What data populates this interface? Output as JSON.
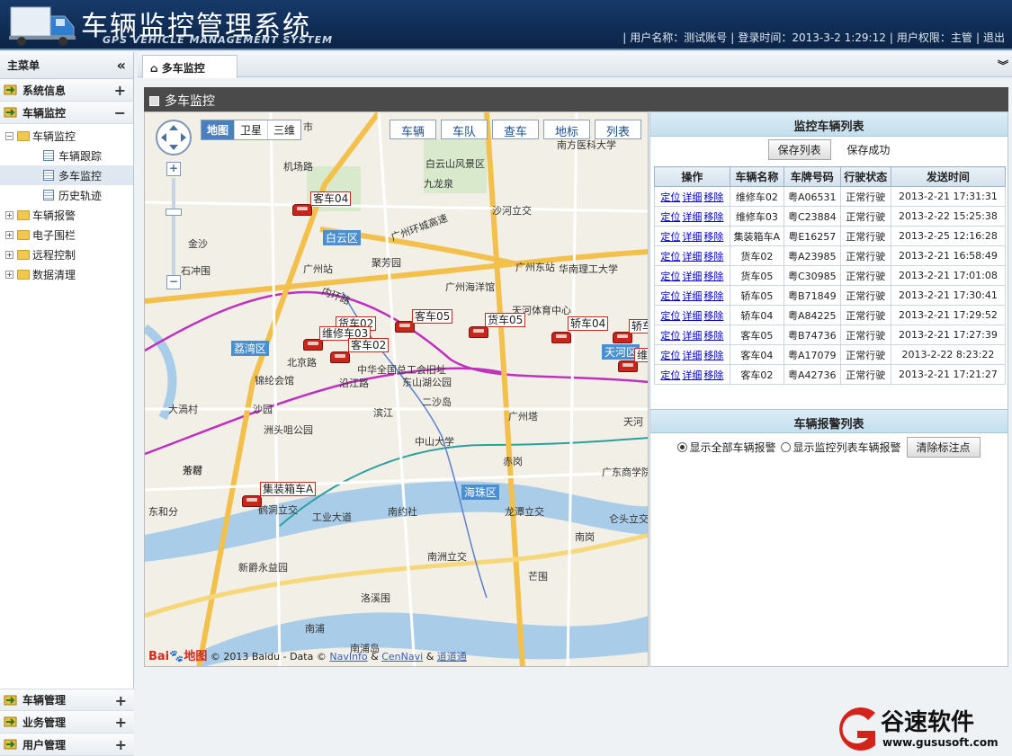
{
  "header": {
    "title": "车辆监控管理系统",
    "subtitle": "GPS VEHICLE MANAGEMENT SYSTEM",
    "user": "用户名称：测试账号",
    "login": "登录时间：2013-3-2 1:29:12",
    "role": "用户权限：主管",
    "logout": "退出"
  },
  "sidebar": {
    "title": "主菜单",
    "collapse": "«",
    "cats": [
      {
        "label": "系统信息",
        "pm": "+"
      },
      {
        "label": "车辆监控",
        "pm": "−"
      }
    ],
    "tree": {
      "root": "车辆监控",
      "children": [
        "车辆跟踪",
        "多车监控",
        "历史轨迹"
      ],
      "others": [
        "车辆报警",
        "电子围栏",
        "远程控制",
        "数据清理"
      ]
    },
    "bottom": [
      {
        "label": "车辆管理",
        "pm": "+"
      },
      {
        "label": "业务管理",
        "pm": "+"
      },
      {
        "label": "用户管理",
        "pm": "+"
      }
    ]
  },
  "tab": {
    "label": "多车监控"
  },
  "panel": {
    "title": "多车监控"
  },
  "map": {
    "types": [
      "地图",
      "卫星",
      "三维"
    ],
    "tools": [
      "车辆",
      "车队",
      "查车",
      "地标",
      "列表"
    ],
    "copyright": "© 2013 Baidu - Data ©",
    "navinfo": "NavInfo",
    "amp": "&",
    "cennavi": "CenNavi",
    "daodao": "道道通",
    "cars": [
      "客车04",
      "货车02",
      "维修车03",
      "客车02",
      "客车05",
      "货车05",
      "轿车04",
      "轿车",
      "维修",
      "集装箱车A"
    ],
    "places": [
      "机场路",
      "白云山风景区",
      "九龙泉",
      "沙河立交",
      "白云区",
      "广州站",
      "聚芳园",
      "广州东站",
      "广州海洋馆",
      "天河体育中心",
      "内环路",
      "荔湾区",
      "北京路",
      "锦纶会馆",
      "中华全国总工会旧址",
      "东山湖公园",
      "沿江路",
      "二沙岛",
      "广州塔",
      "滨江",
      "沙园",
      "洲头咀公园",
      "中山大学",
      "赤岗",
      "海珠区",
      "大渦村",
      "芳村",
      "工业大道",
      "南约社",
      "龙潭立交",
      "南洲立交",
      "新爵永益园",
      "洛溪围",
      "南浦岛",
      "天河区",
      "广州环城高速",
      "南方医科大学",
      "华南理工大学",
      "金沙",
      "石冲围",
      "茶滘",
      "东和分",
      "鹤洞立交",
      "仑头立交",
      "南岗",
      "广东商学院",
      "芒围",
      "市",
      "天河",
      "南浦"
    ]
  },
  "monitor": {
    "title": "监控车辆列表",
    "save": "保存列表",
    "saved": "保存成功",
    "cols": [
      "操作",
      "车辆名称",
      "车牌号码",
      "行驶状态",
      "发送时间"
    ],
    "actions": [
      "定位",
      "详细",
      "移除"
    ],
    "rows": [
      [
        "维修车02",
        "粤A06531",
        "正常行驶",
        "2013-2-21 17:31:31"
      ],
      [
        "维修车03",
        "粤C23884",
        "正常行驶",
        "2013-2-22 15:25:38"
      ],
      [
        "集装箱车A",
        "粤E16257",
        "正常行驶",
        "2013-2-25 12:16:28"
      ],
      [
        "货车02",
        "粤A23985",
        "正常行驶",
        "2013-2-21 16:58:49"
      ],
      [
        "货车05",
        "粤C30985",
        "正常行驶",
        "2013-2-21 17:01:08"
      ],
      [
        "轿车05",
        "粤B71849",
        "正常行驶",
        "2013-2-21 17:30:41"
      ],
      [
        "轿车04",
        "粤A84225",
        "正常行驶",
        "2013-2-21 17:29:52"
      ],
      [
        "客车05",
        "粤B74736",
        "正常行驶",
        "2013-2-21 17:27:39"
      ],
      [
        "客车04",
        "粤A17079",
        "正常行驶",
        "2013-2-22 8:23:22"
      ],
      [
        "客车02",
        "粤A42736",
        "正常行驶",
        "2013-2-21 17:21:27"
      ]
    ]
  },
  "alarm": {
    "title": "车辆报警列表",
    "opt1": "显示全部车辆报警",
    "opt2": "显示监控列表车辆报警",
    "clear": "清除标注点"
  },
  "brand": {
    "name": "谷速软件",
    "url": "www.gususoft.com"
  },
  "colors": {
    "header": "#163a6a",
    "accent": "#c8261b"
  }
}
